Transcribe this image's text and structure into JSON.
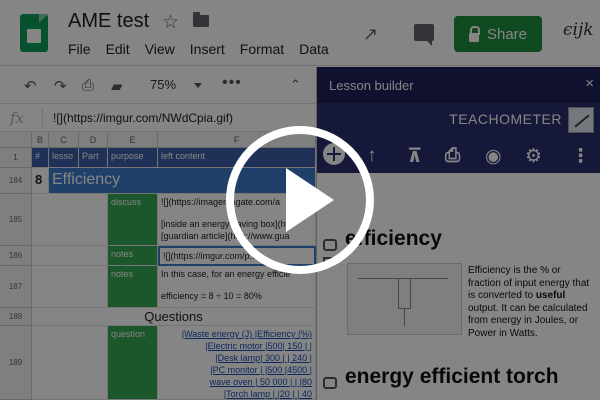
{
  "header": {
    "doc_title": "AME test",
    "menus": [
      "File",
      "Edit",
      "View",
      "Insert",
      "Format",
      "Data"
    ],
    "share_label": "Share",
    "addon_badge": "ϵijk"
  },
  "toolbar": {
    "zoom": "75%",
    "more": "•••"
  },
  "formula_bar": {
    "fx": "fx",
    "value": "![](https://imgur.com/NWdCpia.gif)"
  },
  "sheet": {
    "col_headers": [
      "B",
      "C",
      "D",
      "E",
      "F"
    ],
    "header_row": {
      "num": "1",
      "b": "#",
      "c": "lesso",
      "d": "Part",
      "e": "purpose",
      "f": "left content"
    },
    "rows": [
      {
        "num": "184",
        "b": "8",
        "title": "Efficiency"
      },
      {
        "num": "185",
        "e": "discuss",
        "f1": "![](https://imagemagate.com/a",
        "f2": "[inside an energy saving box](htt",
        "f3": "[guardian article](http://www.gua"
      },
      {
        "num": "186",
        "e": "notes",
        "f1": "![](https://imgur.com/p..."
      },
      {
        "num": "187",
        "e": "notes",
        "f1": "In this case, for an energy efficie",
        "f2": "efficiency = 8 ÷ 10 = 80%"
      },
      {
        "num": "188",
        "title": "Questions"
      },
      {
        "num": "189",
        "e": "question",
        "f_lines": [
          "|Waste energy (J) |Efficiency (%)",
          "|Electric motor |500| 150 |   |",
          "|Desk lamp| 300 |   | 240 |",
          "|PC monitor |   |500 |4500 |",
          "wave oven | 50 000 |   |   |80",
          "|Torch lamp |   |20 |   | 40"
        ]
      }
    ]
  },
  "panel": {
    "title": "Lesson builder",
    "close": "×",
    "brand": "TEACHOMETER",
    "heading1": "efficiency",
    "paragraph_pre": "Efficiency is the % or fraction of input energy that is converted to ",
    "paragraph_bold": "useful",
    "paragraph_post": " output. It can be calculated from energy in Joules, or Power in Watts.",
    "heading2": "energy efficient torch"
  }
}
